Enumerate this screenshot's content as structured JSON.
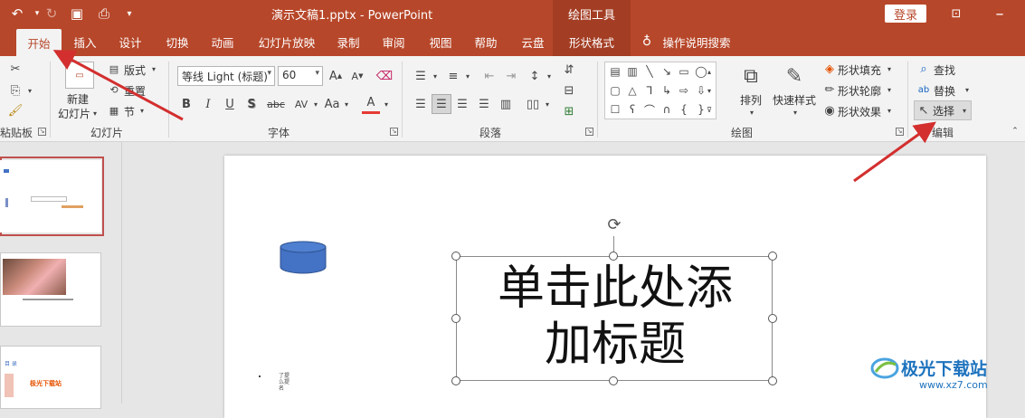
{
  "titlebar": {
    "title": "演示文稿1.pptx  -  PowerPoint",
    "context_title": "绘图工具",
    "login": "登录"
  },
  "tabs": [
    "开始",
    "插入",
    "设计",
    "切换",
    "动画",
    "幻灯片放映",
    "录制",
    "审阅",
    "视图",
    "帮助",
    "云盘",
    "形状格式",
    "操作说明搜索"
  ],
  "ribbon": {
    "clipboard": {
      "label": "粘贴板"
    },
    "slides": {
      "new_slide": "新建",
      "new_slide2": "幻灯片",
      "layout": "版式",
      "reset": "重置",
      "section": "节",
      "label": "幻灯片"
    },
    "font": {
      "family": "等线 Light (标题)",
      "size": "60",
      "label": "字体",
      "bold": "B",
      "italic": "I",
      "underline": "U",
      "shadow": "S",
      "strike": "abc",
      "spacing": "AV",
      "case": "Aa",
      "color": "A"
    },
    "paragraph": {
      "label": "段落"
    },
    "drawing": {
      "arrange": "排列",
      "quick_styles": "快速样式",
      "fill": "形状填充",
      "outline": "形状轮廓",
      "effects": "形状效果",
      "label": "绘图"
    },
    "editing": {
      "find": "查找",
      "replace": "替换",
      "select": "选择",
      "label": "编辑"
    }
  },
  "slide": {
    "title_line1": "单击此处添",
    "title_line2": "加标题",
    "small_text": "了提\n么提\n名"
  },
  "thumb3": {
    "text1": "目 录",
    "text2": "极光下载站"
  },
  "watermark": {
    "text": "极光下载站",
    "url": "www.xz7.com"
  },
  "colors": {
    "accent": "#b7472a",
    "shape_fill": "#4472c4",
    "arrow": "#d32f2f"
  }
}
